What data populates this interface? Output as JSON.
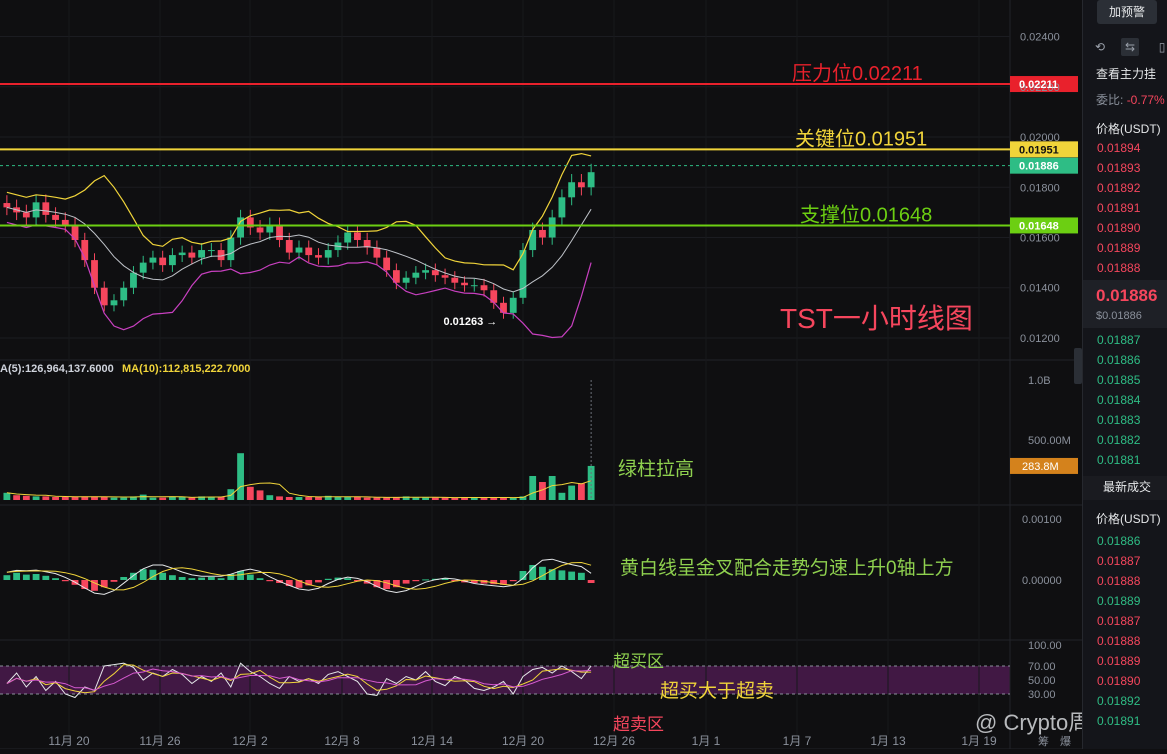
{
  "chart_data": [
    {
      "type": "candlestick",
      "title": "TST一小时线图",
      "ylim": [
        0.0118,
        0.0245
      ],
      "y_ticks": [
        "0.02400",
        "0.02200",
        "0.02000",
        "0.01800",
        "0.01600",
        "0.01400",
        "0.01200"
      ],
      "price_lines": [
        {
          "label": "压力位0.02211",
          "value": 0.02211,
          "tag": "0.02211",
          "color": "#e9212c"
        },
        {
          "label": "关键位0.01951",
          "value": 0.01951,
          "tag": "0.01951",
          "color": "#f0d43a"
        },
        {
          "label": "支撑位0.01648",
          "value": 0.01648,
          "tag": "0.01648",
          "color": "#6ccf12"
        }
      ],
      "current_price": {
        "value": 0.01886,
        "tag": "0.01886"
      },
      "low_marker": {
        "label": "0.01263",
        "value": 0.01263
      },
      "x_ticks": [
        "11月 20",
        "11月 26",
        "12月 2",
        "12月 8",
        "12月 14",
        "12月 20",
        "12月 26",
        "1月 1",
        "1月 7",
        "1月 13",
        "1月 19"
      ],
      "close": [
        0.0172,
        0.017,
        0.0168,
        0.0174,
        0.0169,
        0.0167,
        0.0165,
        0.0159,
        0.0151,
        0.014,
        0.0133,
        0.0135,
        0.014,
        0.0146,
        0.015,
        0.0152,
        0.0149,
        0.0153,
        0.0154,
        0.0152,
        0.0155,
        0.0155,
        0.0151,
        0.016,
        0.0168,
        0.0164,
        0.0162,
        0.0165,
        0.0159,
        0.0154,
        0.0156,
        0.0153,
        0.0152,
        0.0155,
        0.0158,
        0.0162,
        0.0159,
        0.0156,
        0.0152,
        0.0147,
        0.0142,
        0.0144,
        0.0146,
        0.0147,
        0.0145,
        0.0144,
        0.0142,
        0.0141,
        0.0141,
        0.0139,
        0.0134,
        0.013,
        0.0136,
        0.0155,
        0.0163,
        0.016,
        0.0168,
        0.0176,
        0.0182,
        0.018,
        0.0186
      ]
    },
    {
      "type": "bar",
      "title": "Volume",
      "legend": [
        "A(5):126,964,137.6000",
        "MA(10):112,815,222.7000"
      ],
      "y_ticks": [
        "1.0B",
        "500.00M"
      ],
      "last_tag": "283.8M",
      "annotation": "绿柱拉高",
      "values": [
        60,
        40,
        35,
        30,
        30,
        25,
        25,
        25,
        30,
        30,
        25,
        20,
        20,
        30,
        45,
        20,
        20,
        25,
        25,
        20,
        30,
        25,
        25,
        90,
        390,
        110,
        80,
        40,
        30,
        25,
        25,
        25,
        25,
        35,
        25,
        25,
        25,
        20,
        20,
        20,
        25,
        30,
        20,
        20,
        20,
        20,
        20,
        25,
        20,
        20,
        20,
        20,
        20,
        30,
        200,
        150,
        200,
        60,
        120,
        140,
        283.8
      ]
    },
    {
      "type": "bar",
      "title": "MACD",
      "y_ticks": [
        "0.00100",
        "0.00000"
      ],
      "annotation": "黄白线呈金叉配合走势匀速上升0轴上方",
      "values": [
        8e-05,
        0.00012,
        9e-05,
        0.0001,
        7e-05,
        3e-05,
        -2e-05,
        -8e-05,
        -0.00015,
        -0.00018,
        -0.00012,
        -3e-05,
        5e-05,
        0.00012,
        0.00018,
        0.00017,
        0.00012,
        8e-05,
        5e-05,
        3e-05,
        4e-05,
        5e-05,
        3e-05,
        0.0001,
        0.00015,
        9e-05,
        3e-05,
        -2e-05,
        -5e-05,
        -0.0001,
        -0.00013,
        -9e-05,
        -4e-05,
        2e-05,
        4e-05,
        3e-05,
        -2e-05,
        -6e-05,
        -0.00012,
        -0.00015,
        -0.00012,
        -6e-05,
        -2e-05,
        1e-05,
        2e-05,
        3e-05,
        -2e-05,
        -4e-05,
        -5e-05,
        -6e-05,
        -7e-05,
        -8e-05,
        -2e-05,
        0.00015,
        0.00025,
        0.00022,
        0.00018,
        0.00016,
        0.00014,
        0.00012,
        -5e-05
      ]
    },
    {
      "type": "line",
      "title": "RSI",
      "y_ticks": [
        "100.00",
        "70.00",
        "50.00",
        "30.00"
      ],
      "labels": {
        "overbought": "超买区",
        "middle": "超买大于超卖",
        "oversold": "超卖区"
      },
      "values": [
        45,
        60,
        40,
        55,
        35,
        48,
        30,
        25,
        40,
        35,
        70,
        72,
        74,
        68,
        50,
        60,
        55,
        65,
        58,
        45,
        55,
        48,
        60,
        40,
        74,
        62,
        55,
        45,
        38,
        55,
        48,
        52,
        45,
        58,
        62,
        55,
        48,
        30,
        28,
        52,
        45,
        55,
        50,
        62,
        48,
        42,
        55,
        50,
        38,
        35,
        40,
        48,
        30,
        55,
        65,
        68,
        60,
        70,
        62,
        52,
        70
      ]
    }
  ],
  "watermark": "@ Crypto周易",
  "corner_text": [
    "筹",
    "爆"
  ],
  "sidebar": {
    "alert_button": "加预警",
    "order_book_title": "查看主力挂",
    "ratio_label": "委比:",
    "ratio_value": "-0.77%",
    "price_header": "价格(USDT)",
    "asks": [
      "0.01894",
      "0.01893",
      "0.01892",
      "0.01891",
      "0.01890",
      "0.01889",
      "0.01888"
    ],
    "last_price": "0.01886",
    "last_price_usd": "$0.01886",
    "bids": [
      "0.01887",
      "0.01886",
      "0.01885",
      "0.01884",
      "0.01883",
      "0.01882",
      "0.01881"
    ],
    "trades_title": "最新成交",
    "trades_header": "价格(USDT)",
    "trades": [
      {
        "price": "0.01886",
        "side": "buy"
      },
      {
        "price": "0.01887",
        "side": "sell"
      },
      {
        "price": "0.01888",
        "side": "sell"
      },
      {
        "price": "0.01889",
        "side": "buy"
      },
      {
        "price": "0.01887",
        "side": "sell"
      },
      {
        "price": "0.01888",
        "side": "sell"
      },
      {
        "price": "0.01889",
        "side": "sell"
      },
      {
        "price": "0.01890",
        "side": "sell"
      },
      {
        "price": "0.01892",
        "side": "buy"
      },
      {
        "price": "0.01891",
        "side": "buy"
      }
    ]
  }
}
